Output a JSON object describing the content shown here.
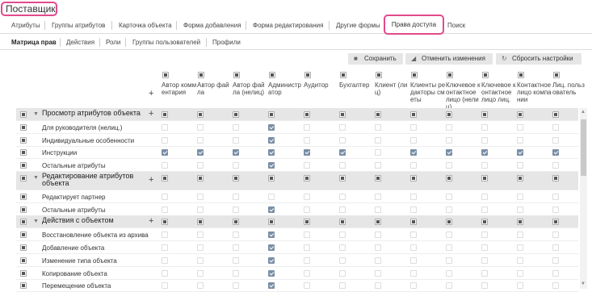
{
  "page_title": "Поставщик",
  "tabs_main": [
    {
      "label": "Атрибуты"
    },
    {
      "label": "Группы атрибутов"
    },
    {
      "label": "Карточка объекта"
    },
    {
      "label": "Форма добавления"
    },
    {
      "label": "Форма редактирования"
    },
    {
      "label": "Другие формы"
    },
    {
      "label": "Права доступа"
    },
    {
      "label": "Поиск"
    }
  ],
  "tabs_sub": [
    {
      "label": "Матрица прав"
    },
    {
      "label": "Действия"
    },
    {
      "label": "Роли"
    },
    {
      "label": "Группы пользователей"
    },
    {
      "label": "Профили"
    }
  ],
  "toolbar": {
    "save": "Сохранить",
    "cancel": "Отменить изменения",
    "reset": "Сбросить настройки"
  },
  "columns": [
    {
      "label": "Автор комментария"
    },
    {
      "label": "Автор файла"
    },
    {
      "label": "Автор файла (нелиц)"
    },
    {
      "label": "Администратор"
    },
    {
      "label": "Аудитор"
    },
    {
      "label": "Бухгалтер"
    },
    {
      "label": "Клиент (лиц)"
    },
    {
      "label": "Клиенты редакторы сметы"
    },
    {
      "label": "Ключевое контактное лицо (нелиц)"
    },
    {
      "label": "Ключевое контактное лицо лиц."
    },
    {
      "label": "Контактное лицо компании"
    },
    {
      "label": "Лиц. пользователь"
    }
  ],
  "rows": [
    {
      "label": "Просмотр атрибутов объекта",
      "group": true,
      "cells": "ssssssssssss"
    },
    {
      "label": "Для руководителя (нелиц.)",
      "group": false,
      "cells": "dddcdddddddd"
    },
    {
      "label": "Индивидуальные особенности",
      "group": false,
      "cells": "dddcdddddddd"
    },
    {
      "label": "Инструкции",
      "group": false,
      "cells": "ccccccdccccc"
    },
    {
      "label": "Остальные атрибуты",
      "group": false,
      "cells": "dddcdddddddd"
    },
    {
      "label": "Редактирование атрибутов объекта",
      "group": true,
      "cells": "ssssssssssss"
    },
    {
      "label": "Редактирует партнер",
      "group": false,
      "cells": "dddddddddddd"
    },
    {
      "label": "Остальные атрибуты",
      "group": false,
      "cells": "dddcdddddddd"
    },
    {
      "label": "Действия с объектом",
      "group": true,
      "cells": "ssssssssssss"
    },
    {
      "label": "Восстановление объекта из архива",
      "group": false,
      "cells": "dddcdddddddd"
    },
    {
      "label": "Добавление объекта",
      "group": false,
      "cells": "dddcdddddddd"
    },
    {
      "label": "Изменение типа объекта",
      "group": false,
      "cells": "dddcdddddddd"
    },
    {
      "label": "Копирование объекта",
      "group": false,
      "cells": "dddcdddddddd"
    },
    {
      "label": "Перемещение объекта",
      "group": false,
      "cells": "dddcdddddddd"
    }
  ],
  "colors": {
    "highlight": "#e24a8c",
    "checked": "#7a8fa6",
    "group_bg": "#e6e6e6"
  }
}
